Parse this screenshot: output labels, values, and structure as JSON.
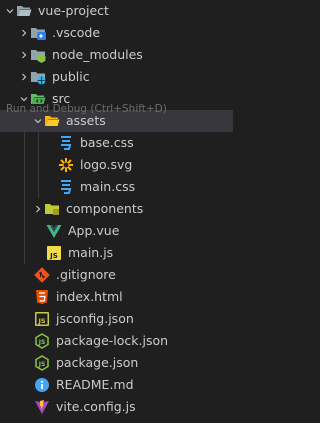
{
  "tooltip": "Run and Debug (Ctrl+Shift+D)",
  "tree": {
    "root": {
      "label": "vue-project"
    },
    "vscode": {
      "label": ".vscode"
    },
    "node_modules": {
      "label": "node_modules"
    },
    "public": {
      "label": "public"
    },
    "src": {
      "label": "src"
    },
    "assets": {
      "label": "assets"
    },
    "base_css": {
      "label": "base.css"
    },
    "logo_svg": {
      "label": "logo.svg"
    },
    "main_css": {
      "label": "main.css"
    },
    "components": {
      "label": "components"
    },
    "app_vue": {
      "label": "App.vue"
    },
    "main_js": {
      "label": "main.js"
    },
    "gitignore": {
      "label": ".gitignore"
    },
    "index_html": {
      "label": "index.html"
    },
    "jsconfig": {
      "label": "jsconfig.json"
    },
    "package_lock": {
      "label": "package-lock.json"
    },
    "package_json": {
      "label": "package.json"
    },
    "readme": {
      "label": "README.md"
    },
    "vite_config": {
      "label": "vite.config.js"
    }
  },
  "colors": {
    "background": "#1f1f1f",
    "selected_row": "#37373d",
    "folder": "#90a4ae",
    "vscode_badge": "#2f80ed",
    "node_badge": "#8bc34a",
    "public_badge": "#29b6f6",
    "src_badge": "#4caf50",
    "assets_folder": "#ffca28",
    "css_icon": "#42a5f5",
    "svg_icon": "#ffb300",
    "vue_icon": "#41b883",
    "js_icon": "#f0db4f",
    "git_icon": "#f4511e",
    "html_icon": "#e65100",
    "json_icon": "#cbcb41",
    "node_json_icon": "#8bc34a",
    "info_icon": "#42a5f5",
    "vite_icon": "#ab47bc"
  }
}
